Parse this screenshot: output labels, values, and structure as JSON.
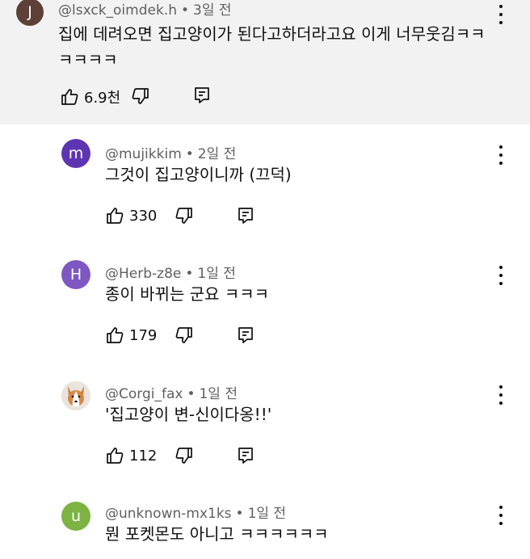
{
  "comments": [
    {
      "avatar_letter": "J",
      "avatar_color": "#5d4037",
      "user": "@lsxck_oimdek.h",
      "time": "3일 전",
      "text_line1": "집에 데려오면 집고양이가 된다고하더라고요 이게 너무웃김ㅋㅋ",
      "text_line2": "ㅋㅋㅋㅋ",
      "likes": "6.9천"
    },
    {
      "avatar_letter": "m",
      "avatar_color": "#5e35b1",
      "user": "@mujikkim",
      "time": "2일 전",
      "text": "그것이 집고양이니까 (끄덕)",
      "likes": "330"
    },
    {
      "avatar_letter": "H",
      "avatar_color": "#7e57c2",
      "user": "@Herb-z8e",
      "time": "1일 전",
      "text": "종이 바뀌는 군요 ㅋㅋㅋ",
      "likes": "179"
    },
    {
      "avatar_icon": "corgi-photo",
      "user": "@Corgi_fax",
      "time": "1일 전",
      "text": "'집고양이 변-신이다옹!!'",
      "likes": "112"
    },
    {
      "avatar_letter": "u",
      "avatar_color": "#7cb342",
      "user": "@unknown-mx1ks",
      "time": "1일 전",
      "text": "뭔 포켓몬도 아니고 ㅋㅋㅋㅋㅋㅋ"
    }
  ],
  "separator": "•",
  "colors": {
    "highlight_bg": "#f2f2f2",
    "meta_text": "#606060"
  }
}
